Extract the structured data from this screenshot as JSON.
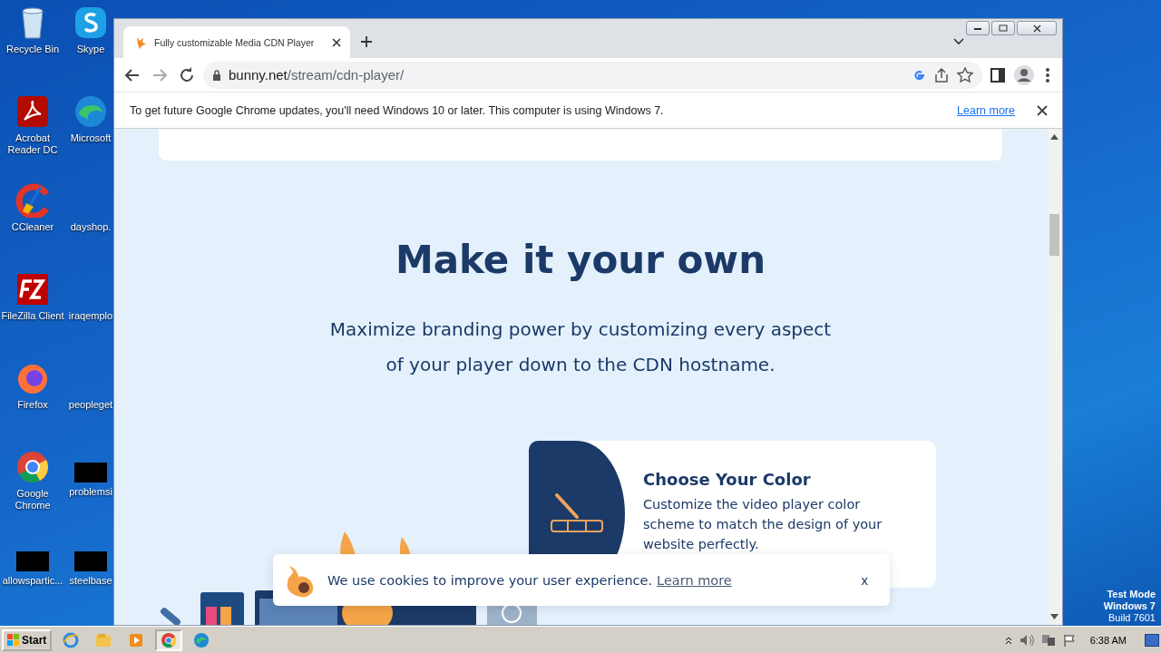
{
  "desktop": {
    "icons": [
      {
        "label": "Recycle Bin",
        "kind": "bin"
      },
      {
        "label": "Skype",
        "kind": "skype"
      },
      {
        "label": "Acrobat Reader DC",
        "kind": "acrobat"
      },
      {
        "label": "Microsoft",
        "kind": "edge"
      },
      {
        "label": "CCleaner",
        "kind": "ccleaner"
      },
      {
        "label": "dayshop.",
        "kind": "blank"
      },
      {
        "label": "FileZilla Client",
        "kind": "filezilla"
      },
      {
        "label": "iraqemplo",
        "kind": "blank"
      },
      {
        "label": "Firefox",
        "kind": "firefox"
      },
      {
        "label": "peopleget",
        "kind": "blank"
      },
      {
        "label": "Google Chrome",
        "kind": "chrome"
      },
      {
        "label": "problemsi",
        "kind": "redacted"
      },
      {
        "label": "allowspartic...",
        "kind": "redacted"
      },
      {
        "label": "steelbase",
        "kind": "redacted"
      }
    ],
    "watermark": [
      "Test Mode",
      "Windows 7",
      "Build 7601"
    ]
  },
  "browser": {
    "tab": {
      "title": "Fully customizable Media CDN Player",
      "selected": true
    },
    "url_host": "bunny.net",
    "url_path": "/stream/cdn-player/",
    "infobar": {
      "message": "To get future Google Chrome updates, you'll need Windows 10 or later. This computer is using Windows 7.",
      "link": "Learn more"
    }
  },
  "page": {
    "heading": "Make it your own",
    "subtitle": [
      "Maximize branding power by customizing every aspect",
      "of your player down to the CDN hostname."
    ],
    "feature": {
      "title": "Choose Your Color",
      "description": "Customize the video player color scheme to match the design of your website perfectly."
    },
    "cookie": {
      "message": "We use cookies to improve your user experience.",
      "link": "Learn more",
      "close": "x"
    }
  },
  "taskbar": {
    "start": "Start",
    "apps": [
      {
        "kind": "ie",
        "selected": false
      },
      {
        "kind": "explorer",
        "selected": false
      },
      {
        "kind": "media",
        "selected": false
      },
      {
        "kind": "chrome",
        "selected": true
      },
      {
        "kind": "edge",
        "selected": false
      }
    ],
    "time": "6:38 AM"
  }
}
